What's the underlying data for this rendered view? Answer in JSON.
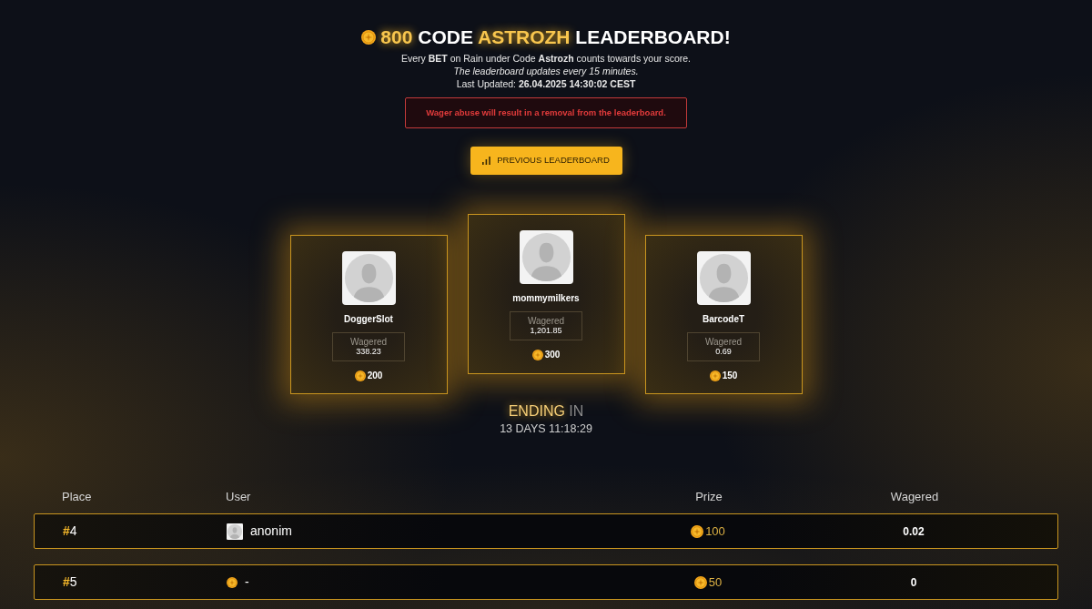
{
  "header": {
    "title_segments": [
      {
        "text": "800",
        "highlight": true
      },
      {
        "text": "CODE",
        "highlight": false
      },
      {
        "text": "ASTROZH",
        "highlight": true
      },
      {
        "text": "LEADERBOARD!",
        "highlight": false
      }
    ],
    "intro": "Every **BET** on Rain under Code **Astrozh** counts towards your score.",
    "note": "The leaderboard updates every 15 minutes.",
    "last_updated": "Last Updated: **26.04.2025 14:30:02 CEST**"
  },
  "warning": "Wager abuse will result in a removal from the leaderboard.",
  "previous_button": {
    "label": "PREVIOUS LEADERBOARD"
  },
  "podium": [
    {
      "name": "DoggerSlot",
      "wagered_label": "Wagered",
      "wagered": "338.23",
      "prize": "200",
      "leading": false
    },
    {
      "name": "mommymilkers",
      "wagered_label": "Wagered",
      "wagered": "1,201.85",
      "prize": "300",
      "leading": true
    },
    {
      "name": "BarcodeT",
      "wagered_label": "Wagered",
      "wagered": "0.69",
      "prize": "150",
      "leading": false
    }
  ],
  "countdown": {
    "segments": [
      {
        "text": "ENDING",
        "highlight": true
      },
      {
        "text": "IN",
        "highlight": false
      }
    ],
    "time": "13 DAYS 11:18:29"
  },
  "table": {
    "columns": [
      "Place",
      "User",
      "Prize",
      "Wagered"
    ],
    "rows": [
      {
        "kind": "user",
        "place_mark": "#",
        "place": "4",
        "user": "anonim",
        "prize": "100",
        "wagered": "0.02"
      },
      {
        "kind": "vacant",
        "place_mark": "#",
        "place": "5",
        "user": "-",
        "prize": "50",
        "wagered": "0"
      }
    ]
  }
}
